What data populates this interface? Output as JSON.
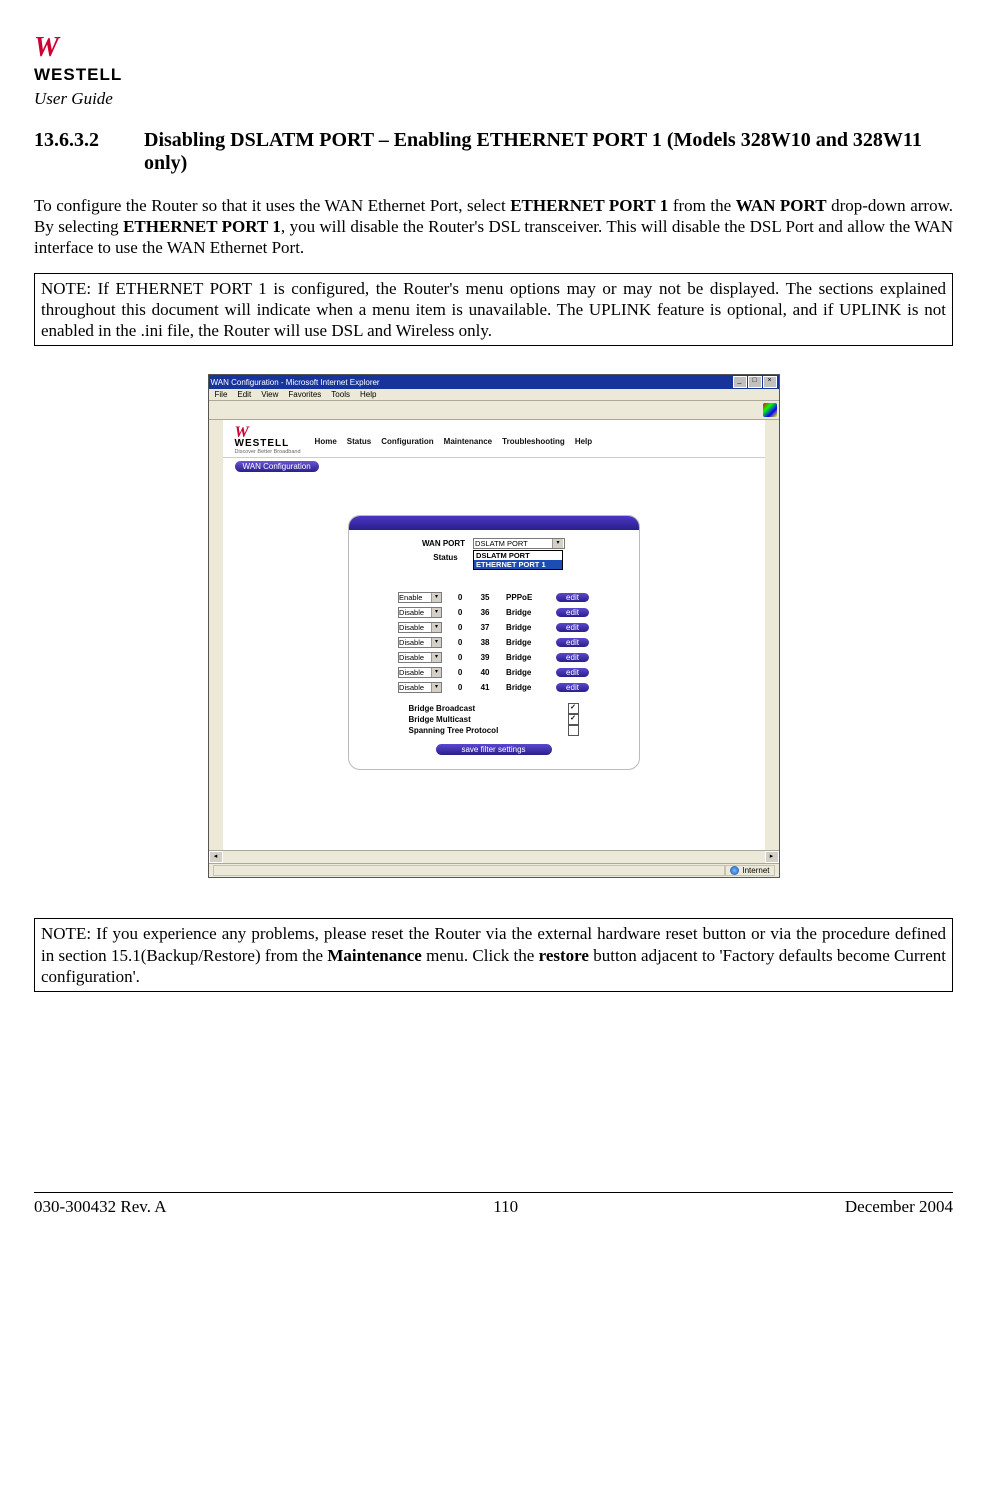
{
  "header": {
    "logo_swoosh": "W",
    "logo_text": "WESTELL",
    "subtitle": "User Guide"
  },
  "section": {
    "number": "13.6.3.2",
    "title": "Disabling DSLATM PORT – Enabling ETHERNET PORT 1 (Models 328W10  and 328W11 only)"
  },
  "paragraph1_parts": {
    "p1": "To configure the Router so that it uses the WAN Ethernet Port, select ",
    "b1": "ETHERNET PORT 1",
    "p2": " from the ",
    "b2": "WAN PORT",
    "p3": " drop-down arrow. By selecting ",
    "b3": "ETHERNET PORT 1",
    "p4": ", you will disable the Router's DSL transceiver. This will disable the DSL Port and allow the WAN interface to use the WAN Ethernet Port."
  },
  "note1": "NOTE: If ETHERNET PORT 1 is configured, the Router's menu options may or may not be displayed. The sections explained throughout this document will indicate when a menu item is unavailable. The UPLINK feature is optional, and if UPLINK is not enabled in the .ini file, the Router will use DSL and Wireless only.",
  "note2_parts": {
    "p1": "NOTE: If you experience any problems, please reset the Router via the external hardware reset button or via the procedure defined in section 15.1(Backup/Restore) from the ",
    "b1": "Maintenance",
    "p2": " menu. Click the ",
    "b2": "restore",
    "p3": " button adjacent to 'Factory defaults become Current configuration'."
  },
  "screenshot": {
    "window_title": "WAN Configuration - Microsoft Internet Explorer",
    "menu": [
      "File",
      "Edit",
      "View",
      "Favorites",
      "Tools",
      "Help"
    ],
    "logo_swoosh": "W",
    "logo_text": "WESTELL",
    "logo_tag": "Discover Better Broadband",
    "nav": [
      "Home",
      "Status",
      "Configuration",
      "Maintenance",
      "Troubleshooting",
      "Help"
    ],
    "subnav": "WAN Configuration",
    "form": {
      "wan_port_label": "WAN PORT",
      "wan_port_value": "DSLATM PORT",
      "status_label": "Status",
      "dropdown_options": [
        "DSLATM PORT",
        "ETHERNET PORT 1"
      ],
      "rows": [
        {
          "state": "Enable",
          "col1": "0",
          "col2": "35",
          "proto": "PPPoE",
          "btn": "edit"
        },
        {
          "state": "Disable",
          "col1": "0",
          "col2": "36",
          "proto": "Bridge",
          "btn": "edit"
        },
        {
          "state": "Disable",
          "col1": "0",
          "col2": "37",
          "proto": "Bridge",
          "btn": "edit"
        },
        {
          "state": "Disable",
          "col1": "0",
          "col2": "38",
          "proto": "Bridge",
          "btn": "edit"
        },
        {
          "state": "Disable",
          "col1": "0",
          "col2": "39",
          "proto": "Bridge",
          "btn": "edit"
        },
        {
          "state": "Disable",
          "col1": "0",
          "col2": "40",
          "proto": "Bridge",
          "btn": "edit"
        },
        {
          "state": "Disable",
          "col1": "0",
          "col2": "41",
          "proto": "Bridge",
          "btn": "edit"
        }
      ],
      "checkboxes": [
        {
          "label": "Bridge Broadcast",
          "checked": true
        },
        {
          "label": "Bridge Multicast",
          "checked": true
        },
        {
          "label": "Spanning Tree Protocol",
          "checked": false
        }
      ],
      "save_label": "save filter settings"
    },
    "status_bar": "Internet"
  },
  "footer": {
    "left": "030-300432 Rev. A",
    "center": "110",
    "right": "December 2004"
  }
}
